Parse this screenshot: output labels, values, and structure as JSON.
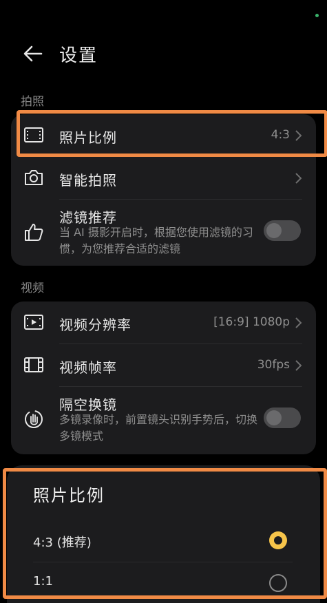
{
  "header": {
    "title": "设置"
  },
  "sections": {
    "photo": {
      "label": "拍照",
      "items": [
        {
          "label": "照片比例",
          "value": "4:3",
          "icon": "aspect-ratio-icon"
        },
        {
          "label": "智能拍照",
          "icon": "camera-icon"
        },
        {
          "label": "滤镜推荐",
          "sub": "当 AI 摄影开启时，根据您使用滤镜的习惯，为您推荐合适的滤镜",
          "icon": "thumbs-up-icon",
          "toggle": false
        }
      ]
    },
    "video": {
      "label": "视频",
      "items": [
        {
          "label": "视频分辨率",
          "value": "[16:9] 1080p",
          "icon": "video-resolution-icon"
        },
        {
          "label": "视频帧率",
          "value": "30fps",
          "icon": "film-icon"
        },
        {
          "label": "隔空换镜",
          "sub": "多镜录像时，前置镜头识别手势后，切换多镜模式",
          "icon": "hand-gesture-icon",
          "toggle": false
        }
      ]
    }
  },
  "sheet": {
    "title": "照片比例",
    "options": [
      {
        "label": "4:3 (推荐)",
        "selected": true
      },
      {
        "label": "1:1",
        "selected": false
      }
    ]
  },
  "colors": {
    "highlight": "#f08a45",
    "accent": "#f6c44a",
    "card": "#1c1c1e"
  }
}
